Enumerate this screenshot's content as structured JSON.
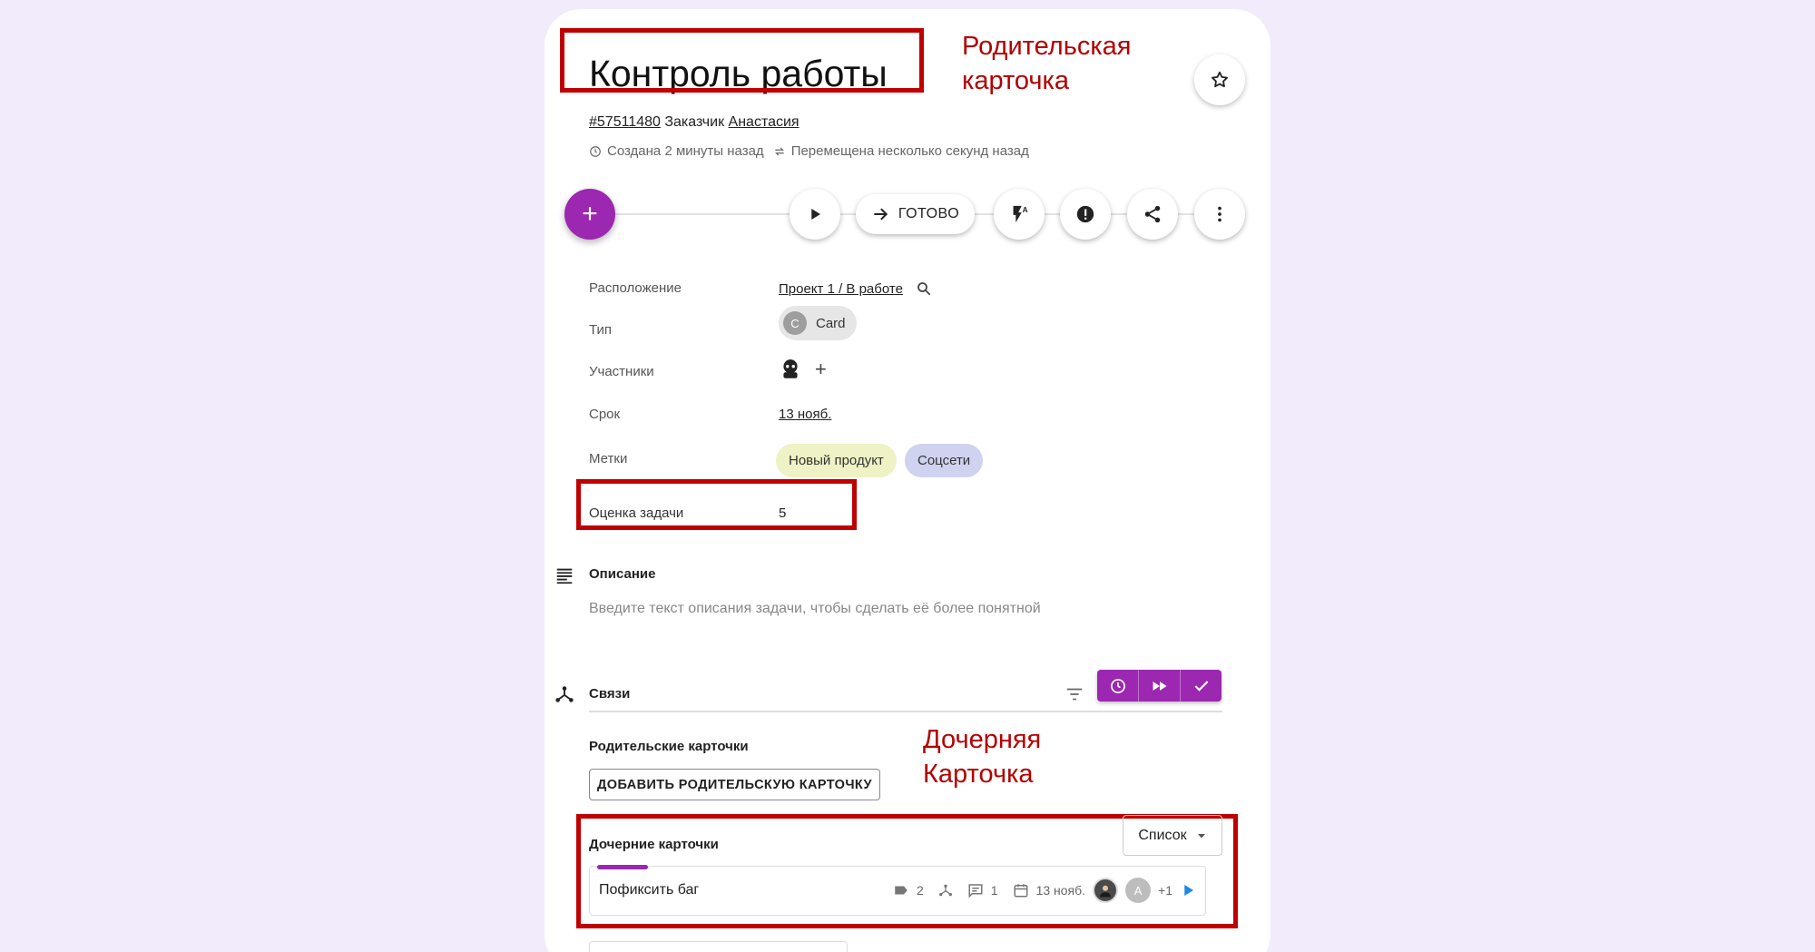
{
  "header": {
    "title": "Контроль работы",
    "id_link": "#57511480",
    "customer_label": "Заказчик",
    "customer_name": "Анастасия",
    "created": "Создана 2 минуты назад",
    "moved": "Перемещена несколько секунд назад"
  },
  "annotations": {
    "parent_line1": "Родительская",
    "parent_line2": "карточка",
    "child_line1": "Дочерняя",
    "child_line2": "Карточка"
  },
  "toolbar": {
    "add_symbol": "+",
    "ready_label": "ГОТОВО"
  },
  "properties": {
    "location_label": "Расположение",
    "location_value": "Проект 1 / В работе",
    "type_label": "Тип",
    "type_initial": "C",
    "type_value": "Card",
    "members_label": "Участники",
    "members_add": "+",
    "deadline_label": "Срок",
    "deadline_value": "13 нояб.",
    "tags_label": "Метки",
    "tags": [
      {
        "label": "Новый продукт",
        "color": "#eef2c4"
      },
      {
        "label": "Соцсети",
        "color": "#d0d3ef"
      }
    ],
    "estimate_label": "Оценка задачи",
    "estimate_value": "5"
  },
  "description": {
    "title": "Описание",
    "placeholder": "Введите текст описания задачи, чтобы сделать её более понятной"
  },
  "links": {
    "title": "Связи",
    "parent_cards_title": "Родительские карточки",
    "add_parent_button": "ДОБАВИТЬ РОДИТЕЛЬСКУЮ КАРТОЧКУ",
    "child_cards_title": "Дочерние карточки",
    "view_select": "Список",
    "child_cards": [
      {
        "name": "Пофиксить баг",
        "tags_count": "2",
        "comments_count": "1",
        "date": "13 нояб.",
        "avatar_letter": "A",
        "extra_members": "+1"
      }
    ]
  },
  "colors": {
    "accent": "#9c27b0",
    "annotation_red": "#c00000",
    "background": "#f2ebfc"
  }
}
